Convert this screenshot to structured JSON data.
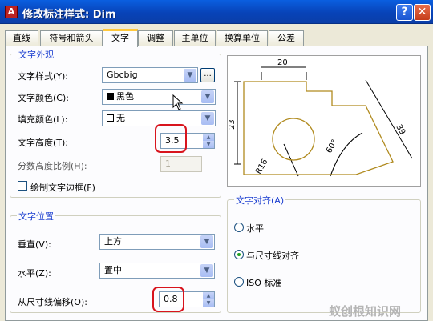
{
  "window": {
    "app_icon": "A",
    "title": "修改标注样式: Dim",
    "help_label": "?",
    "close_label": "✕"
  },
  "tabs": [
    "直线",
    "符号和箭头",
    "文字",
    "调整",
    "主单位",
    "换算单位",
    "公差"
  ],
  "text_appearance": {
    "title": "文字外观",
    "style_label": "文字样式(Y):",
    "style_value": "Gbcbig",
    "style_browse": "...",
    "color_label": "文字颜色(C):",
    "color_value": "黑色",
    "fill_label": "填充颜色(L):",
    "fill_value": "无",
    "height_label": "文字高度(T):",
    "height_value": "3.5",
    "fraction_label": "分数高度比例(H):",
    "fraction_value": "1",
    "frame_label": "绘制文字边框(F)"
  },
  "text_placement": {
    "title": "文字位置",
    "vertical_label": "垂直(V):",
    "vertical_value": "上方",
    "horizontal_label": "水平(Z):",
    "horizontal_value": "置中",
    "offset_label": "从尺寸线偏移(O):",
    "offset_value": "0.8"
  },
  "text_alignment": {
    "title": "文字对齐(A)",
    "options": [
      "水平",
      "与尺寸线对齐",
      "ISO 标准"
    ],
    "selected": "与尺寸线对齐"
  },
  "preview": {
    "dim_top": "20",
    "dim_left": "23",
    "dim_diag": "39",
    "dim_angle": "60°",
    "dim_radius": "R16"
  },
  "watermark": "蚁创根知识网",
  "icons": [
    "app-icon",
    "help-icon",
    "close-icon",
    "chevron-down-icon",
    "spin-up-icon",
    "spin-down-icon",
    "mouse-cursor-icon"
  ],
  "colors": {
    "titlebar": "#0843b8",
    "group_title": "#1c3fd0",
    "highlight": "#d8141d",
    "preview_lines": "#b08a1e"
  }
}
